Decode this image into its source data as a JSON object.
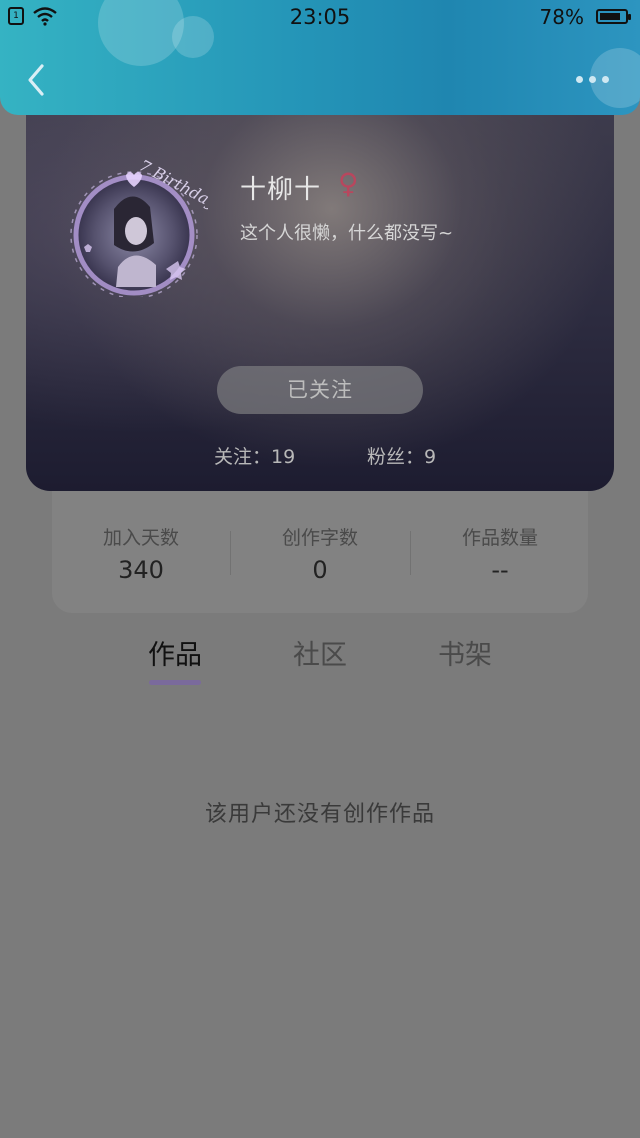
{
  "status_bar": {
    "time": "23:05",
    "battery_percent": "78%",
    "sim_label": "1"
  },
  "header": {
    "back_icon": "chevron-left-icon",
    "more_icon": "more-dots-icon"
  },
  "profile": {
    "avatar_caption": "7 Birthday",
    "name": "十柳十",
    "gender_symbol": "♀",
    "bio": "这个人很懒，什么都没写~",
    "follow_button": "已关注",
    "following_label": "关注：19",
    "followers_label": "粉丝：9"
  },
  "stats": [
    {
      "label": "加入天数",
      "value": "340"
    },
    {
      "label": "创作字数",
      "value": "0"
    },
    {
      "label": "作品数量",
      "value": "--"
    }
  ],
  "tabs": [
    {
      "label": "作品",
      "active": true
    },
    {
      "label": "社区",
      "active": false
    },
    {
      "label": "书架",
      "active": false
    }
  ],
  "empty_message": "该用户还没有创作作品",
  "colors": {
    "accent_purple": "#7a6a9c",
    "header_teal": "#2596b8",
    "gender_pink": "#b8475e"
  }
}
